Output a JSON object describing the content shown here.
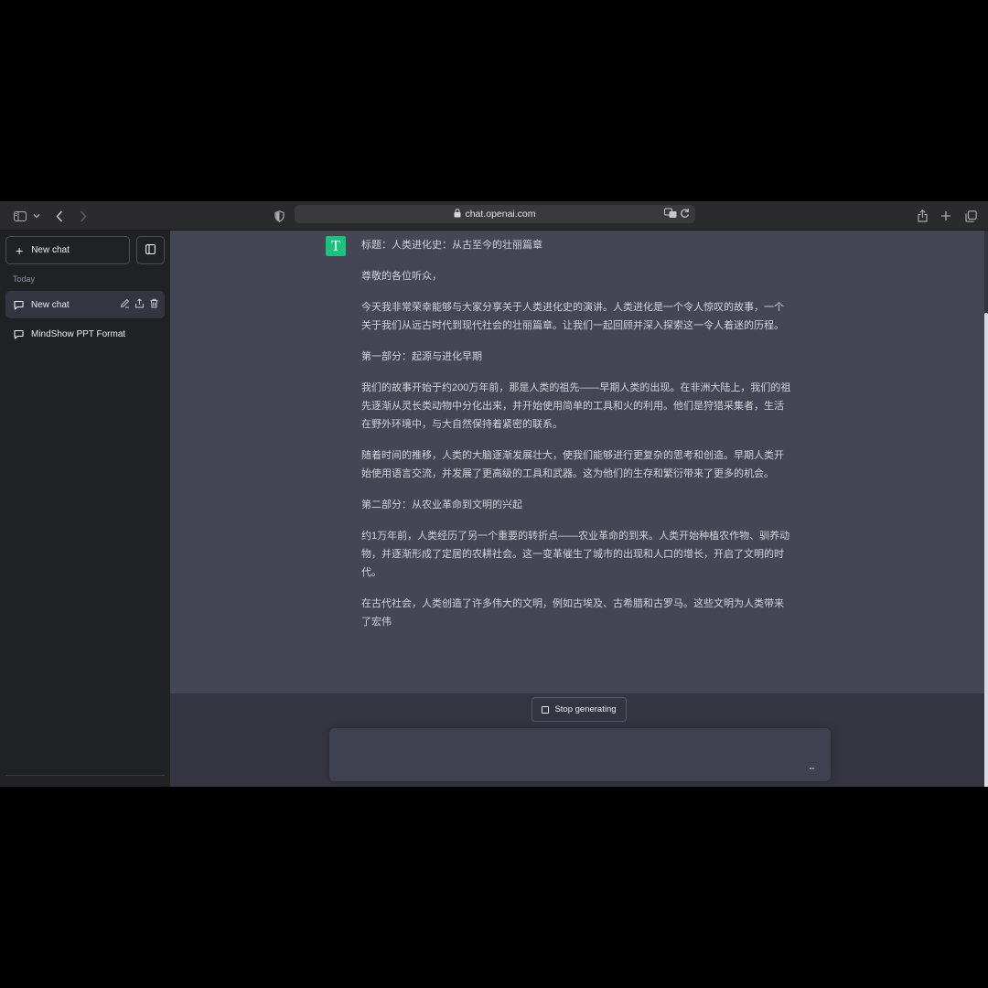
{
  "browser": {
    "url": "chat.openai.com",
    "icons": [
      "sidebar-icon",
      "chevron-down-icon",
      "back-icon",
      "forward-icon",
      "shield-icon",
      "lock-icon",
      "translate-icon",
      "reload-icon",
      "share-icon",
      "plus-icon",
      "tabs-icon"
    ]
  },
  "sidebar": {
    "new_chat_label": "New chat",
    "section_label": "Today",
    "items": [
      {
        "label": "New chat",
        "active": true
      },
      {
        "label": "MindShow PPT Format",
        "active": false
      }
    ]
  },
  "conversation": {
    "avatar_letter": "T",
    "paragraphs": [
      "标题：人类进化史：从古至今的壮丽篇章",
      "尊敬的各位听众，",
      "今天我非常荣幸能够与大家分享关于人类进化史的演讲。人类进化是一个令人惊叹的故事，一个关于我们从远古时代到现代社会的壮丽篇章。让我们一起回顾并深入探索这一令人着迷的历程。",
      "第一部分：起源与进化早期",
      "我们的故事开始于约200万年前，那是人类的祖先——早期人类的出现。在非洲大陆上，我们的祖先逐渐从灵长类动物中分化出来，并开始使用简单的工具和火的利用。他们是狩猎采集者，生活在野外环境中，与大自然保持着紧密的联系。",
      "随着时间的推移，人类的大脑逐渐发展壮大，使我们能够进行更复杂的思考和创造。早期人类开始使用语言交流，并发展了更高级的工具和武器。这为他们的生存和繁衍带来了更多的机会。",
      "第二部分：从农业革命到文明的兴起",
      "约1万年前，人类经历了另一个重要的转折点——农业革命的到来。人类开始种植农作物、驯养动物，并逐渐形成了定居的农耕社会。这一变革催生了城市的出现和人口的增长，开启了文明的时代。",
      "在古代社会，人类创造了许多伟大的文明，例如古埃及、古希腊和古罗马。这些文明为人类带来了宏伟"
    ]
  },
  "controls": {
    "stop_label": "Stop generating",
    "input_placeholder": ""
  },
  "colors": {
    "accent": "#19c37d",
    "sidebar_bg": "#202123",
    "assistant_bg": "#444654",
    "main_bg": "#343541"
  }
}
